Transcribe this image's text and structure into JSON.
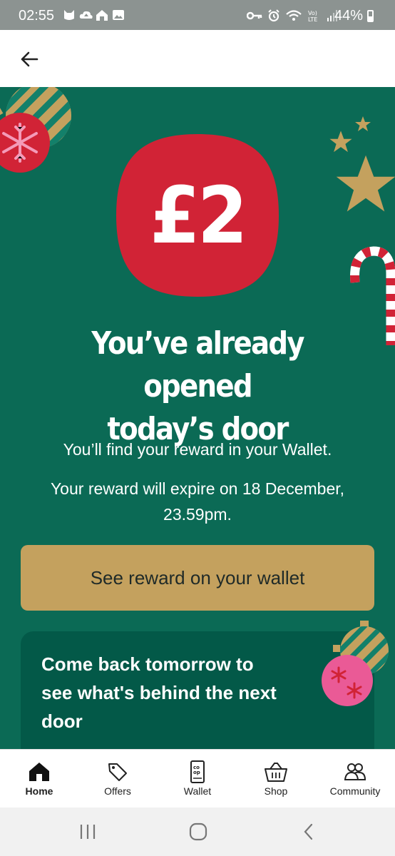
{
  "status_bar": {
    "time": "02:55",
    "battery": "44%",
    "left_icons": [
      "cat-icon",
      "cloud-upload-icon",
      "home-signal-icon",
      "gallery-icon"
    ],
    "right_icons": [
      "key-icon",
      "alarm-icon",
      "wifi-icon",
      "volte-icon",
      "signal-icon"
    ]
  },
  "header": {
    "back_icon": "arrow-left-icon"
  },
  "reward": {
    "amount": "£2",
    "badge_color": "#d12336"
  },
  "message": {
    "headline_line1": "You’ve already opened",
    "headline_line2": "today’s door",
    "find_reward": "You’ll find your reward in your Wallet.",
    "expiry_line1": "Your reward will expire on 18 December,",
    "expiry_line2": "23.59pm."
  },
  "cta": {
    "label": "See reward on your wallet"
  },
  "card": {
    "line1": "Come back tomorrow to",
    "line2": "see what's behind the next",
    "line3": "door"
  },
  "bottom_nav": {
    "items": [
      {
        "label": "Home",
        "icon": "home-icon",
        "active": true
      },
      {
        "label": "Offers",
        "icon": "tag-icon",
        "active": false
      },
      {
        "label": "Wallet",
        "icon": "wallet-card-icon",
        "active": false
      },
      {
        "label": "Shop",
        "icon": "basket-icon",
        "active": false
      },
      {
        "label": "Community",
        "icon": "people-icon",
        "active": false
      }
    ]
  },
  "system_nav": {
    "recents": "recents-icon",
    "home": "home-circle-icon",
    "back": "back-chevron-icon"
  },
  "colors": {
    "background_green": "#0b6a55",
    "card_green": "#035948",
    "cta_gold": "#c4a15e",
    "badge_red": "#d12336"
  }
}
